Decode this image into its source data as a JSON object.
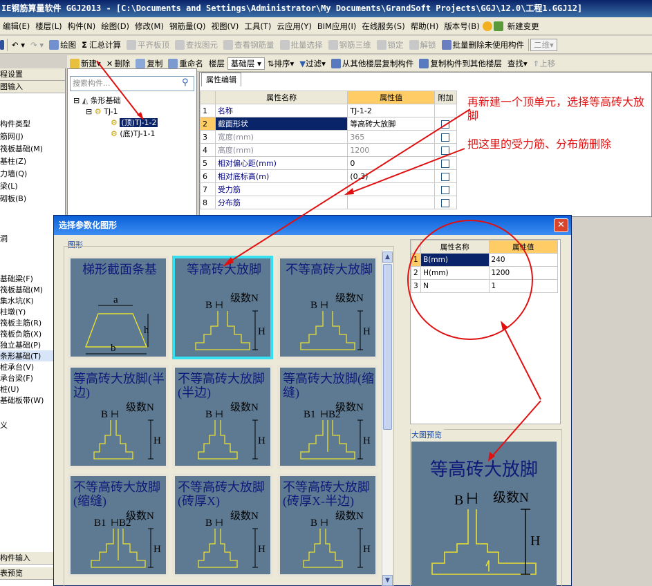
{
  "window_title": "GGJ2013 - [C:\\Documents and Settings\\Administrator\\My Documents\\GrandSoft Projects\\GGJ\\12.0\\工程1.GGJ12]",
  "window_title_prefix": "IE钢筋算量软件",
  "menu": [
    "编辑(E)",
    "楼层(L)",
    "构件(N)",
    "绘图(D)",
    "修改(M)",
    "钢筋量(Q)",
    "视图(V)",
    "工具(T)",
    "云应用(Y)",
    "BIM应用(I)",
    "在线服务(S)",
    "帮助(H)",
    "版本号(B)",
    "新建变更"
  ],
  "toolbar1": {
    "draw": "绘图",
    "summary": "汇总计算",
    "flat_board": "平齐板顶",
    "find_element": "查找图元",
    "view_rebar": "查看钢筋量",
    "batch_select": "批量选择",
    "rebar_3d": "钢筋三维",
    "lock": "锁定",
    "unlock": "解锁",
    "batch_delete": "批量删除未使用构件",
    "view_2d": "二维",
    "sig": "Σ"
  },
  "toolbar2": {
    "new": "新建",
    "delete": "删除",
    "copy": "复制",
    "rename": "重命名",
    "floor": "楼层",
    "floor_value": "基础层",
    "sort": "排序",
    "filter": "过滤",
    "copy_from": "从其他楼层复制构件",
    "copy_to": "复制构件到其他楼层",
    "find": "查找",
    "up": "上移"
  },
  "left_panel": {
    "items": [
      "程设置",
      "图输入",
      "构件类型",
      "筋网(J)",
      "筏板基础(M)",
      "基柱(Z)",
      "力墙(Q)",
      "梁(L)",
      "砌板(B)",
      "洞",
      "基础梁(F)",
      "筏板基础(M)",
      "集水坑(K)",
      "柱墩(Y)",
      "筏板主筋(R)",
      "筏板负筋(X)",
      "独立基础(P)",
      "条形基础(T)",
      "桩承台(V)",
      "承台梁(F)",
      "桩(U)",
      "基础板带(W)",
      "义",
      "构件输入",
      "表预览"
    ],
    "selected": "条形基础(T)"
  },
  "tree": {
    "search_placeholder": "搜索构件...",
    "root": "条形基础",
    "node": "TJ-1",
    "child1": "(顶)TJ-1-2",
    "child2": "(底)TJ-1-1"
  },
  "prop_tab": "属性编辑",
  "prop_headers": [
    "属性名称",
    "属性值",
    "附加"
  ],
  "prop_rows": [
    [
      "1",
      "名称",
      "TJ-1-2"
    ],
    [
      "2",
      "截面形状",
      "等高砖大放脚"
    ],
    [
      "3",
      "宽度(mm)",
      "365"
    ],
    [
      "4",
      "高度(mm)",
      "1200"
    ],
    [
      "5",
      "相对偏心距(mm)",
      "0"
    ],
    [
      "6",
      "相对底标高(m)",
      "(0.3)"
    ],
    [
      "7",
      "受力筋",
      ""
    ],
    [
      "8",
      "分布筋",
      ""
    ]
  ],
  "annotations": {
    "a1": "再新建一个顶单元，选择等高砖大放脚",
    "a2": "把这里的受力筋、分布筋删除"
  },
  "dialog": {
    "title": "选择参数化图形",
    "group": "图形",
    "preview_label": "大图预览",
    "close": "✕"
  },
  "shapes": [
    {
      "title": "梯形截面条基",
      "labels": [
        "a",
        "h",
        "b"
      ]
    },
    {
      "title": "等高砖大放脚",
      "labels": [
        "B",
        "级数N",
        "H"
      ]
    },
    {
      "title": "不等高砖大放脚",
      "labels": [
        "B",
        "级数N",
        "H"
      ]
    },
    {
      "title": "等高砖大放脚(半边)",
      "labels": [
        "B",
        "级数N",
        "H"
      ]
    },
    {
      "title": "不等高砖大放脚(半边)",
      "labels": [
        "B",
        "级数N",
        "H"
      ]
    },
    {
      "title": "等高砖大放脚(缩缝)",
      "labels": [
        "B1",
        "B2",
        "级数N",
        "H"
      ]
    },
    {
      "title": "不等高砖大放脚(缩缝)",
      "labels": [
        "B1",
        "B2",
        "级数N",
        "H"
      ]
    },
    {
      "title": "不等高砖大放脚(砖厚X)",
      "labels": [
        "B",
        "级数N",
        "H"
      ]
    },
    {
      "title": "不等高砖大放脚(砖厚X-半边)",
      "labels": [
        "B",
        "级数N",
        "H"
      ]
    }
  ],
  "shape_selected": "等高砖大放脚",
  "param_headers": [
    "属性名称",
    "属性值"
  ],
  "params": [
    [
      "1",
      "B(mm)",
      "240"
    ],
    [
      "2",
      "H(mm)",
      "1200"
    ],
    [
      "3",
      "N",
      "1"
    ]
  ],
  "preview": {
    "title": "等高砖大放脚",
    "labels": [
      "B",
      "级数N",
      "H"
    ]
  }
}
